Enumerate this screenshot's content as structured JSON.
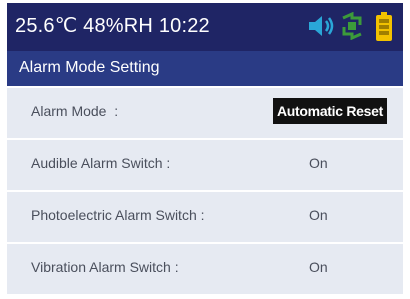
{
  "status_bar": {
    "text": "25.6℃ 48%RH 10:22",
    "icons": [
      "speaker-icon",
      "recycle-icon",
      "battery-icon"
    ],
    "background": "#1f2565"
  },
  "title_bar": {
    "title": "Alarm Mode Setting",
    "background": "#2a3b85"
  },
  "settings": [
    {
      "label": "Alarm Mode  :",
      "value": "Automatic Reset",
      "selected": true
    },
    {
      "label": "Audible Alarm Switch :",
      "value": "On",
      "selected": false
    },
    {
      "label": "Photoelectric Alarm Switch :",
      "value": "On",
      "selected": false
    },
    {
      "label": "Vibration Alarm Switch :",
      "value": "On",
      "selected": false
    }
  ],
  "colors": {
    "row_background": "#e6eaf2",
    "text": "#4a4f5c",
    "icon_cyan": "#2aa7d8",
    "icon_green": "#3c9b3a",
    "icon_yellow": "#f2c200"
  }
}
